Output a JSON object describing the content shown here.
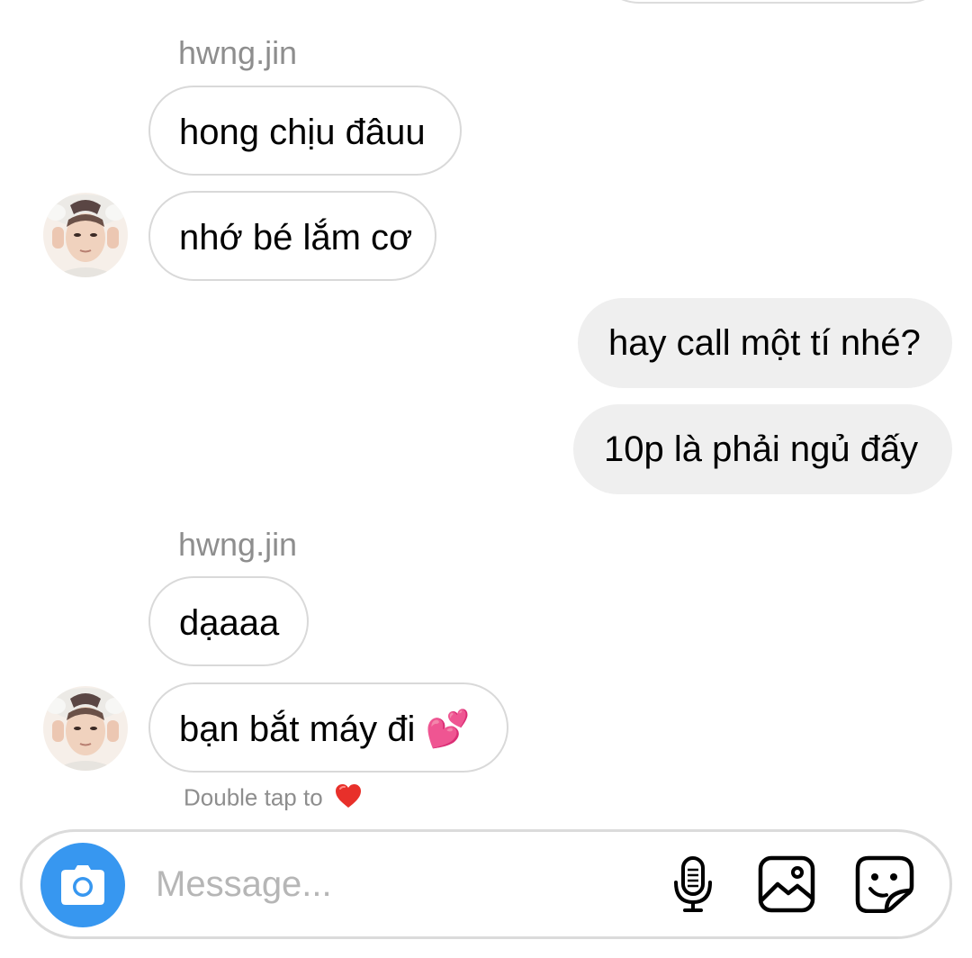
{
  "thread": {
    "groups": [
      {
        "sender": "hwng.jin",
        "messages": [
          "hong chịu đâuu",
          "nhớ bé lắm cơ"
        ]
      },
      {
        "outgoing": [
          "hay call một tí nhé?",
          "10p là phải ngủ đấy"
        ]
      },
      {
        "sender": "hwng.jin",
        "messages": [
          "dạaaa",
          "bạn bắt máy đi 💕"
        ]
      }
    ],
    "double_tap_hint": "Double tap to"
  },
  "composer": {
    "placeholder": "Message...",
    "icons": [
      "camera-icon",
      "microphone-icon",
      "gallery-icon",
      "sticker-icon"
    ]
  },
  "colors": {
    "accent_blue": "#3797f0",
    "outgoing_bubble": "#efefef",
    "incoming_border": "#d9d9d9",
    "muted_text": "#8e8e8e",
    "heart": "#e8302a"
  }
}
